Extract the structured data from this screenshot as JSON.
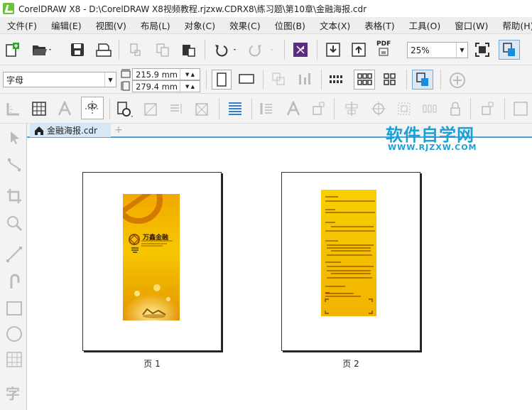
{
  "window": {
    "title": "CorelDRAW X8 - D:\\CorelDRAW X8视频教程.rjzxw.CDRX8\\练习题\\第10章\\金融海报.cdr"
  },
  "menu": [
    {
      "label": "文件(F)"
    },
    {
      "label": "编辑(E)"
    },
    {
      "label": "视图(V)"
    },
    {
      "label": "布局(L)"
    },
    {
      "label": "对象(C)"
    },
    {
      "label": "效果(C)"
    },
    {
      "label": "位图(B)"
    },
    {
      "label": "文本(X)"
    },
    {
      "label": "表格(T)"
    },
    {
      "label": "工具(O)"
    },
    {
      "label": "窗口(W)"
    },
    {
      "label": "帮助(H)"
    }
  ],
  "toolbar": {
    "zoom_value": "25%",
    "pdf_label": "PDF"
  },
  "property_bar": {
    "paper_preset": "字母",
    "width": "215.9 mm",
    "height": "279.4 mm"
  },
  "document_tab": {
    "label": "金融海报.cdr"
  },
  "pages": [
    {
      "label": "页 1",
      "poster_brand": "万鑫金融"
    },
    {
      "label": "页 2"
    }
  ],
  "watermark": {
    "line1": "软件自学网",
    "line2": "WWW.RJZXW.COM"
  },
  "left_tool_text": "字",
  "colors": {
    "poster_yellow": "#f5c000",
    "poster_orange": "#e6a000",
    "accent_blue": "#1aa0d8",
    "tab_underline": "#4aa3df"
  }
}
